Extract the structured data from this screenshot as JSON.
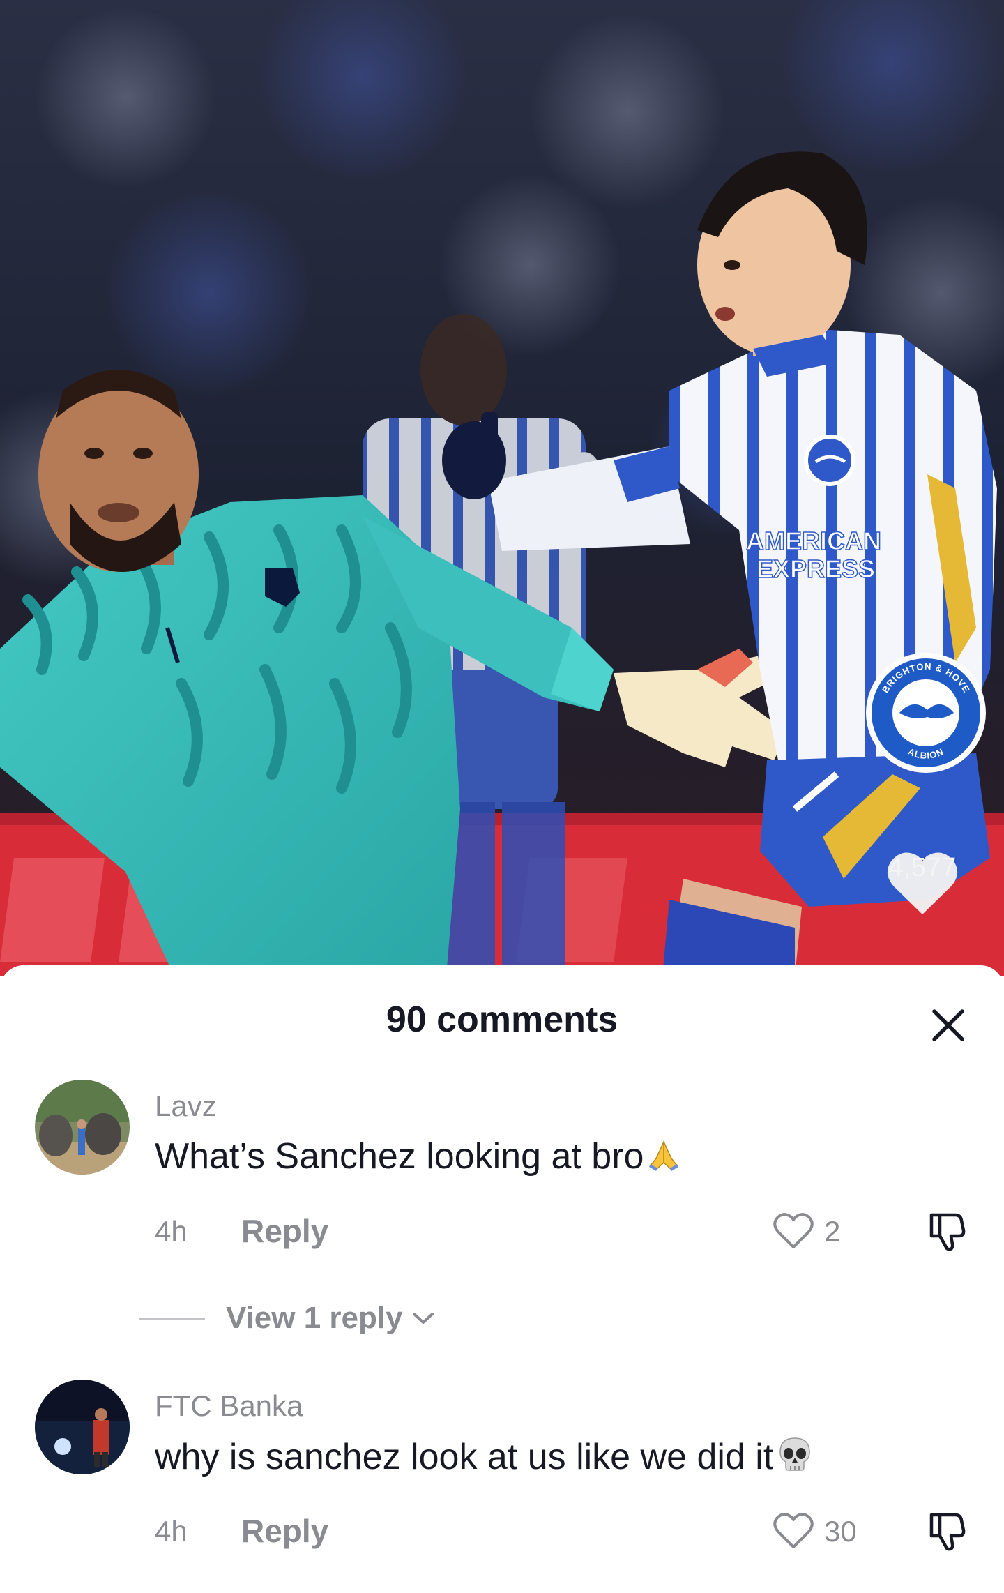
{
  "video": {
    "like_count": "4,577",
    "shirt_sponsor_line1": "AMERICAN",
    "shirt_sponsor_line2": "EXPRESS",
    "badge_top": "BRIGHTON & HOVE",
    "badge_bottom": "ALBION"
  },
  "comments_sheet": {
    "title": "90 comments",
    "comments": [
      {
        "username": "Lavz",
        "text": "What’s Sanchez looking at bro",
        "emoji": "folded-hands",
        "time": "4h",
        "reply_label": "Reply",
        "likes": "2",
        "view_replies_label": "View 1 reply"
      },
      {
        "username": "FTC Banka",
        "text": "why is sanchez look at us like we did it",
        "emoji": "skull",
        "time": "4h",
        "reply_label": "Reply",
        "likes": "30"
      }
    ]
  },
  "colors": {
    "text_primary": "#161823",
    "text_secondary": "#8a8b91",
    "sheet_background": "#ffffff"
  }
}
